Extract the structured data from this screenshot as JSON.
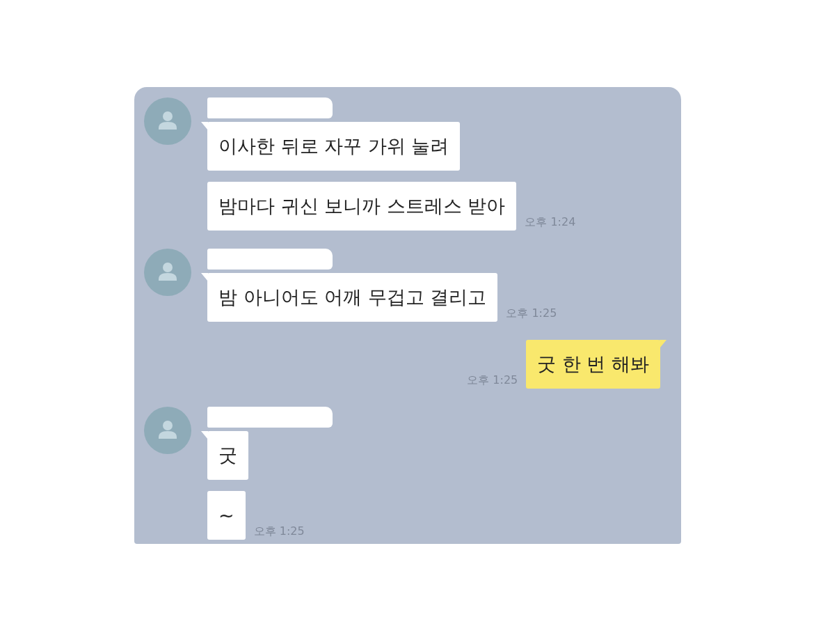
{
  "messages": [
    {
      "kind": "incoming",
      "bubbles": [
        {
          "text": "이사한 뒤로 자꾸 가위 눌려"
        },
        {
          "text": "밤마다 귀신 보니까 스트레스 받아"
        }
      ],
      "time": "오후 1:24"
    },
    {
      "kind": "incoming",
      "bubbles": [
        {
          "text": "밤 아니어도 어깨 무겁고 결리고"
        }
      ],
      "time": "오후 1:25"
    },
    {
      "kind": "outgoing",
      "bubbles": [
        {
          "text": "굿 한 번 해봐"
        }
      ],
      "time": "오후 1:25"
    },
    {
      "kind": "incoming",
      "bubbles": [
        {
          "text": "굿"
        },
        {
          "text": "~"
        }
      ],
      "time": "오후 1:25"
    }
  ]
}
